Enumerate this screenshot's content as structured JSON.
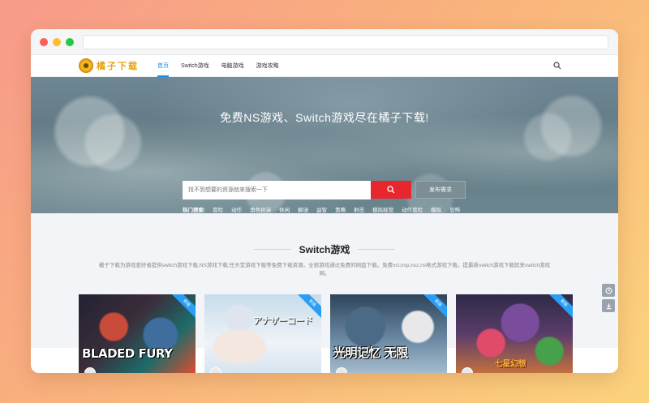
{
  "logo": {
    "text": "橘子下载",
    "icon": "orange-logo-icon"
  },
  "nav": {
    "links": [
      {
        "label": "首页",
        "active": true
      },
      {
        "label": "Switch游戏",
        "active": false
      },
      {
        "label": "电脑游戏",
        "active": false
      },
      {
        "label": "游戏攻略",
        "active": false
      }
    ],
    "search_icon": "search-icon"
  },
  "hero": {
    "title": "免费NS游戏、Switch游戏尽在橘子下载!",
    "search_placeholder": "找不到想要的资源就来搜索一下",
    "post_button": "发布需求",
    "hot_label": "热门搜索:",
    "hot_tags": [
      "冒险",
      "动作",
      "角色扮演",
      "休闲",
      "解谜",
      "益智",
      "策略",
      "射击",
      "模拟经营",
      "动作冒险",
      "模拟",
      "恐怖"
    ]
  },
  "section": {
    "title": "Switch游戏",
    "description": "橘子下载为游戏爱好者提供switch游戏下载,NS游戏下载,任天堂游戏下载等免费下载资源。全部游戏通过免费的网盘下载。免费xci,nsp,nsz,ns格式游戏下载。提最新switch游戏下载就来switch游戏网。"
  },
  "cards": [
    {
      "art_text": "BLADED FURY",
      "ribbon": "新版"
    },
    {
      "art_text": "アナザーコード",
      "ribbon": "新版"
    },
    {
      "art_text": "光明记忆 无限",
      "ribbon": "新版"
    },
    {
      "art_text": "七星幻想",
      "ribbon": "新版"
    }
  ],
  "colors": {
    "accent": "#1e88e5",
    "search_button": "#e8262d",
    "ribbon": "#2a9df4"
  }
}
